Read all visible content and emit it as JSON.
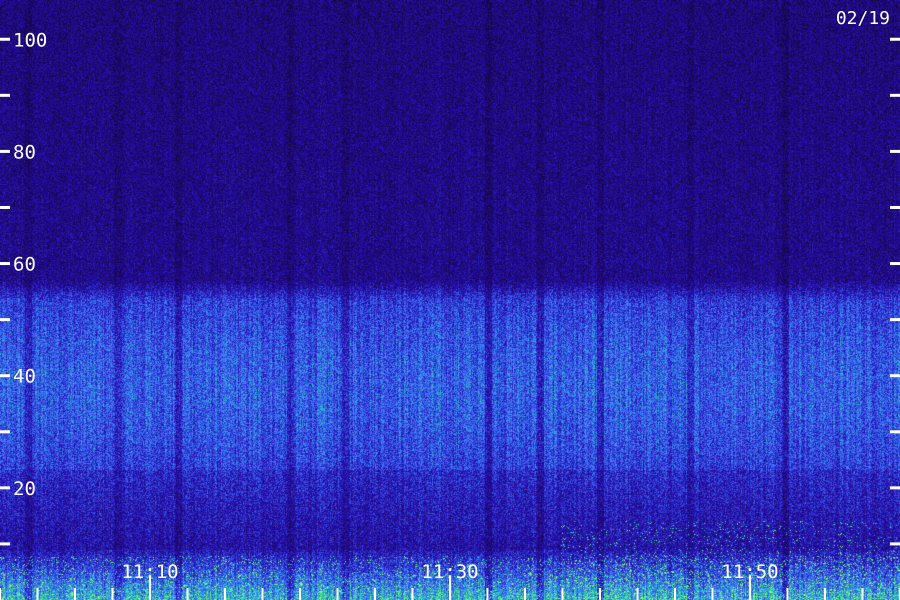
{
  "chart_data": {
    "type": "heatmap",
    "date_label": "02/19",
    "y_ticks": [
      {
        "value": 100,
        "label": "100"
      },
      {
        "value": 90,
        "label": ""
      },
      {
        "value": 80,
        "label": "80"
      },
      {
        "value": 70,
        "label": ""
      },
      {
        "value": 60,
        "label": "60"
      },
      {
        "value": 50,
        "label": ""
      },
      {
        "value": 40,
        "label": "40"
      },
      {
        "value": 30,
        "label": ""
      },
      {
        "value": 20,
        "label": "20"
      },
      {
        "value": 10,
        "label": ""
      }
    ],
    "ylim": [
      0,
      107
    ],
    "x_ticks": [
      {
        "value": "11:10",
        "label": "11:10"
      },
      {
        "value": "11:30",
        "label": "11:30"
      },
      {
        "value": "11:50",
        "label": "11:50"
      }
    ],
    "colors": {
      "background": "#1a0850",
      "low": "#140540",
      "mid": "#2a20d0",
      "high": "#3fa0ff",
      "hot": "#40ff80",
      "axis": "#ffffff"
    }
  }
}
